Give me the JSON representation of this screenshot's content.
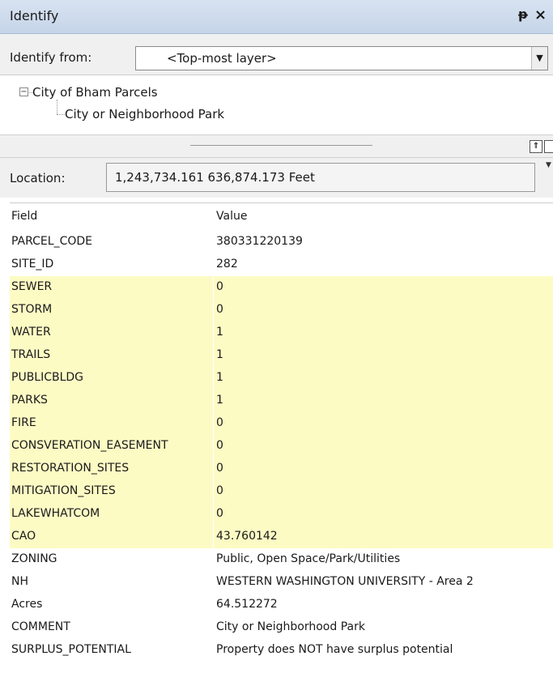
{
  "window": {
    "title": "Identify",
    "pin_glyph": "ᵖ",
    "close_glyph": "×"
  },
  "identify_from": {
    "label": "Identify from:",
    "value": "<Top-most layer>"
  },
  "tree": {
    "layer": "City of Bham Parcels",
    "feature": "City or Neighborhood Park"
  },
  "location": {
    "label": "Location:",
    "value": "1,243,734.161  636,874.173 Feet"
  },
  "table": {
    "header": {
      "field": "Field",
      "value": "Value"
    },
    "rows": [
      {
        "field": "PARCEL_CODE",
        "value": "380331220139",
        "highlight": false
      },
      {
        "field": "SITE_ID",
        "value": "282",
        "highlight": false
      },
      {
        "field": "SEWER",
        "value": "0",
        "highlight": true
      },
      {
        "field": "STORM",
        "value": "0",
        "highlight": true
      },
      {
        "field": "WATER",
        "value": "1",
        "highlight": true
      },
      {
        "field": "TRAILS",
        "value": "1",
        "highlight": true
      },
      {
        "field": "PUBLICBLDG",
        "value": "1",
        "highlight": true
      },
      {
        "field": "PARKS",
        "value": "1",
        "highlight": true
      },
      {
        "field": "FIRE",
        "value": "0",
        "highlight": true
      },
      {
        "field": "CONSVERATION_EASEMENT",
        "value": "0",
        "highlight": true
      },
      {
        "field": "RESTORATION_SITES",
        "value": "0",
        "highlight": true
      },
      {
        "field": "MITIGATION_SITES",
        "value": "0",
        "highlight": true
      },
      {
        "field": "LAKEWHATCOM",
        "value": "0",
        "highlight": true
      },
      {
        "field": "CAO",
        "value": "43.760142",
        "highlight": true
      },
      {
        "field": "ZONING",
        "value": "Public, Open Space/Park/Utilities",
        "highlight": false
      },
      {
        "field": "NH",
        "value": "WESTERN WASHINGTON UNIVERSITY - Area 2",
        "highlight": false
      },
      {
        "field": "Acres",
        "value": "64.512272",
        "highlight": false
      },
      {
        "field": "COMMENT",
        "value": "City or Neighborhood Park",
        "highlight": false
      },
      {
        "field": "SURPLUS_POTENTIAL",
        "value": "Property does NOT have surplus potential",
        "highlight": false
      }
    ]
  },
  "colors": {
    "highlight": "#fdfbc4",
    "titlebar": "#c5d4e8"
  }
}
